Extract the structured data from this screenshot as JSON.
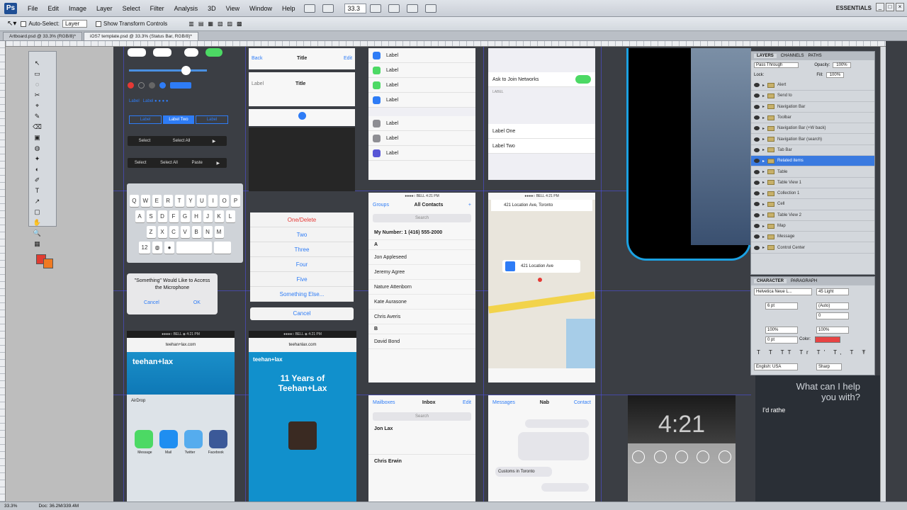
{
  "menubar": {
    "items": [
      "File",
      "Edit",
      "Image",
      "Layer",
      "Select",
      "Filter",
      "Analysis",
      "3D",
      "View",
      "Window",
      "Help"
    ],
    "zoom": "33.3",
    "workspace": "ESSENTIALS"
  },
  "options": {
    "auto_select": "Auto-Select:",
    "auto_select_value": "Layer",
    "show_transform": "Show Transform Controls"
  },
  "doc_tabs": [
    "Artboard.psd @ 33.3% (RGB/8)*",
    "iOS7 template.psd @ 33.3% (Status Bar, RGB/8)*"
  ],
  "status": {
    "zoom": "33.3%",
    "doc": "Doc: 36.2M/339.4M"
  },
  "tools": [
    "↖",
    "▭",
    "◌",
    "✂",
    "⌖",
    "✎",
    "⌫",
    "▣",
    "◍",
    "✦",
    "◐",
    "✐",
    "T",
    "↗",
    "▢",
    "✋",
    "🔍",
    "▦"
  ],
  "kit": {
    "toggle_row": [
      "Label",
      "Label",
      "Label"
    ],
    "nav1": {
      "back": "Back",
      "title": "Title",
      "action": "Edit"
    },
    "nav2": {
      "left": "Label",
      "title": "Title"
    },
    "segment": [
      "Label",
      "Label Two",
      "Label"
    ],
    "dark_seg1": [
      "Select",
      "Select All"
    ],
    "dark_seg2": [
      "Select",
      "Select All",
      "Paste"
    ],
    "keyboard_rows": [
      [
        "Q",
        "W",
        "E",
        "R",
        "T",
        "Y",
        "U",
        "I",
        "O",
        "P"
      ],
      [
        "A",
        "S",
        "D",
        "F",
        "G",
        "H",
        "J",
        "K",
        "L"
      ],
      [
        "Z",
        "X",
        "C",
        "V",
        "B",
        "N",
        "M"
      ]
    ],
    "alert": {
      "title": "\"Something\" Would Like to Access the Microphone",
      "cancel": "Cancel",
      "ok": "OK"
    },
    "action_sheet": [
      "One/Delete",
      "Two",
      "Three",
      "Four",
      "Five",
      "Something Else..."
    ],
    "action_cancel": "Cancel",
    "settings_rows": [
      "Label",
      "Label",
      "Label",
      "Label",
      "Label",
      "Label",
      "Label"
    ],
    "wifi": {
      "ask": "Ask to Join Networks",
      "label_one": "Label One",
      "label_two": "Label Two",
      "section": "LABEL"
    },
    "contacts": {
      "back": "Groups",
      "title": "All Contacts",
      "search": "Search",
      "my_number": "My Number: 1 (416) 555-2000",
      "names": [
        "Jon Appleseed",
        "Jeremy Agree",
        "Nature Attenborn",
        "Kate Aurasone",
        "Chris Averis",
        "David Bond"
      ],
      "sections": [
        "A",
        "B"
      ]
    },
    "map": {
      "address": "421 Location Ave, Toronto",
      "pin": "421 Location Ave"
    },
    "browser1": {
      "url": "teehan+lax.com",
      "brand": "teehan+lax",
      "share": [
        "Message",
        "Mail",
        "Twitter",
        "Facebook"
      ],
      "airdrop": "AirDrop"
    },
    "browser2": {
      "url": "teehanlax.com",
      "brand": "teehan+lax",
      "headline": "11 Years of Teehan+Lax"
    },
    "mail": {
      "back": "Mailboxes",
      "title": "Inbox",
      "edit": "Edit",
      "search": "Search",
      "items": [
        "Jon Lax",
        "Chris Erwin"
      ]
    },
    "messages": {
      "back": "Messages",
      "title": "Nab",
      "contact": "Contact",
      "bubble": "Customs in Toronto"
    },
    "lock": {
      "time": "4:21"
    },
    "siri": {
      "prompt": "What can I help you with?",
      "reply": "I'd rathe"
    }
  },
  "layers_panel": {
    "tabs": [
      "LAYERS",
      "CHANNELS",
      "PATHS"
    ],
    "blend": "Pass Through",
    "opacity_label": "Opacity:",
    "opacity": "100%",
    "fill_label": "Fill:",
    "fill": "100%",
    "lock": "Lock:",
    "rows": [
      "Alert",
      "Send to",
      "Navigation Bar",
      "Toolbar",
      "Navigation Bar (+W back)",
      "Navigation Bar (search)",
      "Tab Bar",
      "Related items",
      "Table",
      "Table View 1",
      "Collection 1",
      "Cell",
      "Table View 2",
      "Map",
      "Message",
      "Control Center"
    ],
    "selected_index": 7
  },
  "character_panel": {
    "tabs": [
      "CHARACTER",
      "PARAGRAPH"
    ],
    "font": "Helvetica Neue L...",
    "style": "45 Light",
    "size": "6 pt",
    "leading": "(Auto)",
    "kerning": "0",
    "scale_v": "100%",
    "scale_h": "100%",
    "baseline": "0 pt",
    "color_label": "Color:",
    "language": "English: USA",
    "aa": "Sharp",
    "color": "#e74343"
  }
}
